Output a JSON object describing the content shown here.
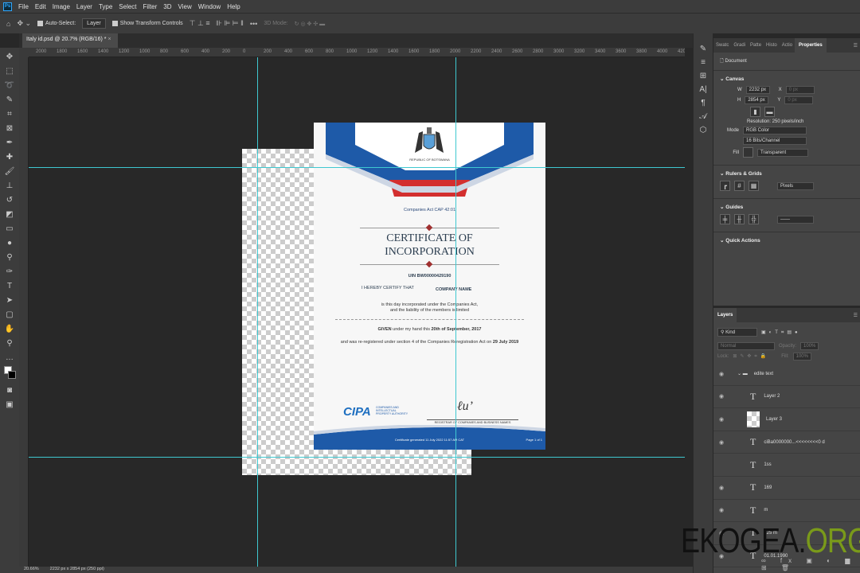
{
  "menu": {
    "logo": "Ps",
    "items": [
      "File",
      "Edit",
      "Image",
      "Layer",
      "Type",
      "Select",
      "Filter",
      "3D",
      "View",
      "Window",
      "Help"
    ]
  },
  "options": {
    "auto_select": "Auto-Select:",
    "layer_select": "Layer",
    "show_transform": "Show Transform Controls",
    "more": "•••",
    "mode_3d": "3D Mode:"
  },
  "tab": {
    "title": "Italy id.psd @ 20.7% (RGB/16) *",
    "close": "×"
  },
  "ruler": {
    "h_labels": [
      "2000",
      "1800",
      "1600",
      "1400",
      "1200",
      "1000",
      "800",
      "600",
      "400",
      "200",
      "0",
      "200",
      "400",
      "600",
      "800",
      "1000",
      "1200",
      "1400",
      "1600",
      "1800",
      "2000",
      "2200",
      "2400",
      "2600",
      "2800",
      "3000",
      "3200",
      "3400",
      "3600",
      "3800",
      "4000",
      "4200"
    ]
  },
  "certificate": {
    "emblem_caption": "REPUBLIC OF BOTSWANA",
    "act": "Companies Act CAP 42:01",
    "title_line1": "CERTIFICATE OF",
    "title_line2": "INCORPORATION",
    "uin": "UIN BW00000429190",
    "certify": "I HEREBY CERTIFY THAT",
    "company": "COMPANY NAME",
    "incorporated1": "is this day incorporated under the Companies Act,",
    "incorporated2": "and the liability of the members is limited",
    "given_pre": "GIVEN",
    "given_mid": " under my hand this ",
    "given_date": "20th of September, 2017",
    "rereg_text": "and was re-registered under section 4 of the Companies Reregistration Act on ",
    "rereg_date": "29 July 2019",
    "logo_text": "CIPA",
    "logo_sub": "COMPANIES AND INTELLECTUAL PROPERTY AUTHORITY",
    "registrar": "REGISTRAR OF COMPANIES AND BUSINESS NAMES",
    "generated": "Certificate generated 11 July 2022 11:57 AM CAT",
    "page": "Page 1 of 1"
  },
  "status": {
    "zoom": "20.66%",
    "size": "2232 px x 2854 px (250 ppi)"
  },
  "properties": {
    "tabs": [
      "Swatc",
      "Gradi",
      "Patte",
      "Histo",
      "Actio",
      "Properties"
    ],
    "document": "Document",
    "canvas": "Canvas",
    "w_label": "W",
    "w": "2232 px",
    "h_label": "H",
    "h": "2854 px",
    "x_label": "X",
    "x": "0 px",
    "y_label": "Y",
    "y": "0 px",
    "resolution": "Resolution: 250 pixels/inch",
    "mode_label": "Mode",
    "mode": "RGB Color",
    "depth": "16 Bits/Channel",
    "fill_label": "Fill",
    "fill": "Transparent",
    "rulers": "Rulers & Grids",
    "units": "Pixels",
    "guides": "Guides",
    "quick": "Quick Actions"
  },
  "layers": {
    "title": "Layers",
    "kind": "Kind",
    "blend": "Normal",
    "opacity_label": "Opacity:",
    "opacity": "100%",
    "lock": "Lock:",
    "fill_label": "Fill:",
    "fill": "100%",
    "items": [
      {
        "name": "edite text",
        "type": "group"
      },
      {
        "name": "Layer 2",
        "type": "text"
      },
      {
        "name": "Layer 3",
        "type": "image"
      },
      {
        "name": "ciBa0000000...<<<<<<<<0 d",
        "type": "text"
      },
      {
        "name": "1ss",
        "type": "text"
      },
      {
        "name": "169",
        "type": "text"
      },
      {
        "name": "m",
        "type": "text"
      },
      {
        "name": "125 m",
        "type": "text"
      },
      {
        "name": "01.01.1990",
        "type": "text"
      }
    ]
  },
  "watermark": {
    "part1": "EKOGEA.",
    "part2": "ORG"
  },
  "colors": {
    "accent_blue": "#1e5aa8",
    "accent_red": "#d32f2f",
    "guide": "#3fc8d0",
    "watermark_green": "#7a9a1a"
  }
}
